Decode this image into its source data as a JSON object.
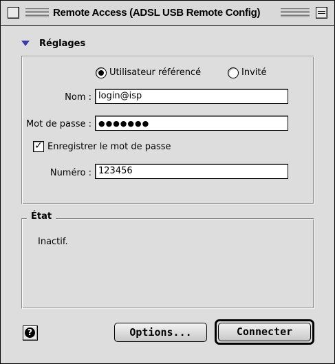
{
  "window": {
    "title": "Remote Access (ADSL USB Remote Config)"
  },
  "settings": {
    "section_label": "Réglages",
    "options": [
      {
        "label": "Utilisateur référencé",
        "selected": true
      },
      {
        "label": "Invité",
        "selected": false
      }
    ],
    "name_label": "Nom :",
    "name_value": "login@isp",
    "password_label": "Mot de passe :",
    "password_value": "●●●●●●●",
    "save_password_label": "Enregistrer le mot de passe",
    "save_password_checked": true,
    "number_label": "Numéro :",
    "number_value": "123456"
  },
  "status": {
    "label": "État",
    "text": "Inactif."
  },
  "buttons": {
    "help": "?",
    "options": "Options...",
    "connect": "Connecter"
  },
  "icons": {
    "close": "close-box-icon",
    "collapse": "collapse-box-icon",
    "disclosure": "disclosure-triangle-icon",
    "help": "help-icon",
    "check": "✓"
  }
}
